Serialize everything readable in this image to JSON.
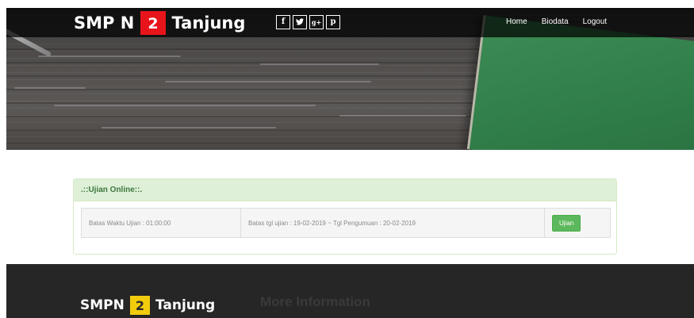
{
  "header": {
    "brand": {
      "prefix": "SMP N",
      "number": "2",
      "suffix": "Tanjung"
    },
    "socials": [
      {
        "icon": "facebook-icon",
        "glyph": "f"
      },
      {
        "icon": "twitter-icon",
        "glyph": "𝕪"
      },
      {
        "icon": "google-plus-icon",
        "glyph": "g+"
      },
      {
        "icon": "pinterest-icon",
        "glyph": "p"
      }
    ],
    "nav": [
      "Home",
      "Biodata",
      "Logout"
    ]
  },
  "panel": {
    "heading": ".::Ujian Online::.",
    "duration": "Batas Waktu Ujian : 01:00:00",
    "dates": "Batas tgl ujian : 19-02-2019 ~ Tgl Pengumuan : 20-02-2019",
    "button_label": "Ujian"
  },
  "footer": {
    "brand": {
      "prefix": "SMPN",
      "number": "2",
      "suffix": "Tanjung"
    },
    "more": "More Information"
  },
  "colors": {
    "brand_red": "#e8141b",
    "footer_yellow": "#f2cc0c",
    "panel_green_bg": "#dff0d8",
    "button_green": "#5cb85c"
  }
}
